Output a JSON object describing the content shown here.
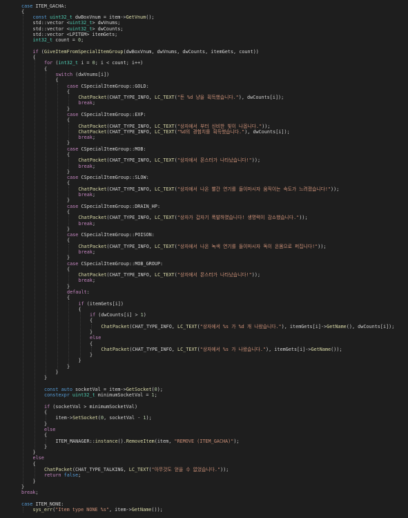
{
  "theme": {
    "background": "#1e1e1e",
    "keyword": "#569cd6",
    "control": "#c586c0",
    "type": "#4ec9b0",
    "function": "#dcdcaa",
    "string": "#ce9178",
    "number": "#b5cea8",
    "text": "#d4d4d4"
  },
  "code_lines": [
    {
      "indent": 0,
      "tokens": [
        [
          "kw",
          "case "
        ],
        [
          "plain",
          "ITEM_GACHA:"
        ]
      ]
    },
    {
      "indent": 0,
      "tokens": [
        [
          "plain",
          "{"
        ]
      ]
    },
    {
      "indent": 1,
      "tokens": [
        [
          "kw",
          "const "
        ],
        [
          "type",
          "uint32_t "
        ],
        [
          "plain",
          "dwBoxVnum = item->"
        ],
        [
          "fn",
          "GetVnum"
        ],
        [
          "plain",
          "();"
        ]
      ]
    },
    {
      "indent": 1,
      "tokens": [
        [
          "plain",
          "std::vector <"
        ],
        [
          "type",
          "uint32_t"
        ],
        [
          "plain",
          "> dwVnums;"
        ]
      ]
    },
    {
      "indent": 1,
      "tokens": [
        [
          "plain",
          "std::vector <"
        ],
        [
          "type",
          "uint32_t"
        ],
        [
          "plain",
          "> dwCounts;"
        ]
      ]
    },
    {
      "indent": 1,
      "tokens": [
        [
          "plain",
          "std::vector <LPITEM> itemGets;"
        ]
      ]
    },
    {
      "indent": 1,
      "tokens": [
        [
          "type",
          "int32_t "
        ],
        [
          "plain",
          "count = "
        ],
        [
          "num",
          "0"
        ],
        [
          "plain",
          ";"
        ]
      ]
    },
    {
      "indent": 1,
      "tokens": []
    },
    {
      "indent": 1,
      "tokens": [
        [
          "ctl",
          "if "
        ],
        [
          "plain",
          "("
        ],
        [
          "fn",
          "GiveItemFromSpecialItemGroup"
        ],
        [
          "plain",
          "(dwBoxVnum, dwVnums, dwCounts, itemGets, count))"
        ]
      ]
    },
    {
      "indent": 1,
      "tokens": [
        [
          "plain",
          "{"
        ]
      ]
    },
    {
      "indent": 2,
      "tokens": [
        [
          "ctl",
          "for "
        ],
        [
          "plain",
          "("
        ],
        [
          "type",
          "int32_t "
        ],
        [
          "plain",
          "i = "
        ],
        [
          "num",
          "0"
        ],
        [
          "plain",
          "; i < count; i++)"
        ]
      ]
    },
    {
      "indent": 2,
      "tokens": [
        [
          "plain",
          "{"
        ]
      ]
    },
    {
      "indent": 3,
      "tokens": [
        [
          "ctl",
          "switch "
        ],
        [
          "plain",
          "(dwVnums[i])"
        ]
      ]
    },
    {
      "indent": 3,
      "tokens": [
        [
          "plain",
          "{"
        ]
      ]
    },
    {
      "indent": 4,
      "tokens": [
        [
          "ctl",
          "case "
        ],
        [
          "plain",
          "CSpecialItemGroup::GOLD:"
        ]
      ]
    },
    {
      "indent": 4,
      "tokens": [
        [
          "plain",
          "{"
        ]
      ]
    },
    {
      "indent": 5,
      "tokens": [
        [
          "fn",
          "ChatPacket"
        ],
        [
          "plain",
          "(CHAT_TYPE_INFO, "
        ],
        [
          "fn",
          "LC_TEXT"
        ],
        [
          "plain",
          "("
        ],
        [
          "str",
          "\"돈 %d 냥을 획득했습니다.\""
        ],
        [
          "plain",
          "), dwCounts[i]);"
        ]
      ]
    },
    {
      "indent": 5,
      "tokens": [
        [
          "ctl",
          "break"
        ],
        [
          "plain",
          ";"
        ]
      ]
    },
    {
      "indent": 4,
      "tokens": [
        [
          "plain",
          "}"
        ]
      ]
    },
    {
      "indent": 4,
      "tokens": [
        [
          "ctl",
          "case "
        ],
        [
          "plain",
          "CSpecialItemGroup::EXP:"
        ]
      ]
    },
    {
      "indent": 4,
      "tokens": [
        [
          "plain",
          "{"
        ]
      ]
    },
    {
      "indent": 5,
      "tokens": [
        [
          "fn",
          "ChatPacket"
        ],
        [
          "plain",
          "(CHAT_TYPE_INFO, "
        ],
        [
          "fn",
          "LC_TEXT"
        ],
        [
          "plain",
          "("
        ],
        [
          "str",
          "\"상자에서 부터 신비한 빛이 나옵니다.\""
        ],
        [
          "plain",
          "));"
        ]
      ]
    },
    {
      "indent": 5,
      "tokens": [
        [
          "fn",
          "ChatPacket"
        ],
        [
          "plain",
          "(CHAT_TYPE_INFO, "
        ],
        [
          "fn",
          "LC_TEXT"
        ],
        [
          "plain",
          "("
        ],
        [
          "str",
          "\"%d의 경험치를 획득했습니다.\""
        ],
        [
          "plain",
          "), dwCounts[i]);"
        ]
      ]
    },
    {
      "indent": 5,
      "tokens": [
        [
          "ctl",
          "break"
        ],
        [
          "plain",
          ";"
        ]
      ]
    },
    {
      "indent": 4,
      "tokens": [
        [
          "plain",
          "}"
        ]
      ]
    },
    {
      "indent": 4,
      "tokens": [
        [
          "ctl",
          "case "
        ],
        [
          "plain",
          "CSpecialItemGroup::MOB:"
        ]
      ]
    },
    {
      "indent": 4,
      "tokens": [
        [
          "plain",
          "{"
        ]
      ]
    },
    {
      "indent": 5,
      "tokens": [
        [
          "fn",
          "ChatPacket"
        ],
        [
          "plain",
          "(CHAT_TYPE_INFO, "
        ],
        [
          "fn",
          "LC_TEXT"
        ],
        [
          "plain",
          "("
        ],
        [
          "str",
          "\"상자에서 몬스터가 나타났습니다!\""
        ],
        [
          "plain",
          "));"
        ]
      ]
    },
    {
      "indent": 5,
      "tokens": [
        [
          "ctl",
          "break"
        ],
        [
          "plain",
          ";"
        ]
      ]
    },
    {
      "indent": 4,
      "tokens": [
        [
          "plain",
          "}"
        ]
      ]
    },
    {
      "indent": 4,
      "tokens": [
        [
          "ctl",
          "case "
        ],
        [
          "plain",
          "CSpecialItemGroup::SLOW:"
        ]
      ]
    },
    {
      "indent": 4,
      "tokens": [
        [
          "plain",
          "{"
        ]
      ]
    },
    {
      "indent": 5,
      "tokens": [
        [
          "fn",
          "ChatPacket"
        ],
        [
          "plain",
          "(CHAT_TYPE_INFO, "
        ],
        [
          "fn",
          "LC_TEXT"
        ],
        [
          "plain",
          "("
        ],
        [
          "str",
          "\"상자에서 나온 빨간 연기를 들이마시자 움직이는 속도가 느려졌습니다!\""
        ],
        [
          "plain",
          "));"
        ]
      ]
    },
    {
      "indent": 5,
      "tokens": [
        [
          "ctl",
          "break"
        ],
        [
          "plain",
          ";"
        ]
      ]
    },
    {
      "indent": 4,
      "tokens": [
        [
          "plain",
          "}"
        ]
      ]
    },
    {
      "indent": 4,
      "tokens": [
        [
          "ctl",
          "case "
        ],
        [
          "plain",
          "CSpecialItemGroup::DRAIN_HP:"
        ]
      ]
    },
    {
      "indent": 4,
      "tokens": [
        [
          "plain",
          "{"
        ]
      ]
    },
    {
      "indent": 5,
      "tokens": [
        [
          "fn",
          "ChatPacket"
        ],
        [
          "plain",
          "(CHAT_TYPE_INFO, "
        ],
        [
          "fn",
          "LC_TEXT"
        ],
        [
          "plain",
          "("
        ],
        [
          "str",
          "\"상자가 갑자기 폭발하였습니다! 생명력이 감소했습니다.\""
        ],
        [
          "plain",
          "));"
        ]
      ]
    },
    {
      "indent": 5,
      "tokens": [
        [
          "ctl",
          "break"
        ],
        [
          "plain",
          ";"
        ]
      ]
    },
    {
      "indent": 4,
      "tokens": [
        [
          "plain",
          "}"
        ]
      ]
    },
    {
      "indent": 4,
      "tokens": [
        [
          "ctl",
          "case "
        ],
        [
          "plain",
          "CSpecialItemGroup::POISON:"
        ]
      ]
    },
    {
      "indent": 4,
      "tokens": [
        [
          "plain",
          "{"
        ]
      ]
    },
    {
      "indent": 5,
      "tokens": [
        [
          "fn",
          "ChatPacket"
        ],
        [
          "plain",
          "(CHAT_TYPE_INFO, "
        ],
        [
          "fn",
          "LC_TEXT"
        ],
        [
          "plain",
          "("
        ],
        [
          "str",
          "\"상자에서 나온 녹색 연기를 들이마시자 독이 온몸으로 퍼집니다!\""
        ],
        [
          "plain",
          "));"
        ]
      ]
    },
    {
      "indent": 5,
      "tokens": [
        [
          "ctl",
          "break"
        ],
        [
          "plain",
          ";"
        ]
      ]
    },
    {
      "indent": 4,
      "tokens": [
        [
          "plain",
          "}"
        ]
      ]
    },
    {
      "indent": 4,
      "tokens": [
        [
          "ctl",
          "case "
        ],
        [
          "plain",
          "CSpecialItemGroup::MOB_GROUP:"
        ]
      ]
    },
    {
      "indent": 4,
      "tokens": [
        [
          "plain",
          "{"
        ]
      ]
    },
    {
      "indent": 5,
      "tokens": [
        [
          "fn",
          "ChatPacket"
        ],
        [
          "plain",
          "(CHAT_TYPE_INFO, "
        ],
        [
          "fn",
          "LC_TEXT"
        ],
        [
          "plain",
          "("
        ],
        [
          "str",
          "\"상자에서 몬스터가 나타났습니다!\""
        ],
        [
          "plain",
          "));"
        ]
      ]
    },
    {
      "indent": 5,
      "tokens": [
        [
          "ctl",
          "break"
        ],
        [
          "plain",
          ";"
        ]
      ]
    },
    {
      "indent": 4,
      "tokens": [
        [
          "plain",
          "}"
        ]
      ]
    },
    {
      "indent": 4,
      "tokens": [
        [
          "ctl",
          "default"
        ],
        [
          "plain",
          ":"
        ]
      ]
    },
    {
      "indent": 4,
      "tokens": [
        [
          "plain",
          "{"
        ]
      ]
    },
    {
      "indent": 5,
      "tokens": [
        [
          "ctl",
          "if "
        ],
        [
          "plain",
          "(itemGets[i])"
        ]
      ]
    },
    {
      "indent": 5,
      "tokens": [
        [
          "plain",
          "{"
        ]
      ]
    },
    {
      "indent": 6,
      "tokens": [
        [
          "ctl",
          "if "
        ],
        [
          "plain",
          "(dwCounts[i] > "
        ],
        [
          "num",
          "1"
        ],
        [
          "plain",
          ")"
        ]
      ]
    },
    {
      "indent": 6,
      "tokens": [
        [
          "plain",
          "{"
        ]
      ]
    },
    {
      "indent": 7,
      "tokens": [
        [
          "fn",
          "ChatPacket"
        ],
        [
          "plain",
          "(CHAT_TYPE_INFO, "
        ],
        [
          "fn",
          "LC_TEXT"
        ],
        [
          "plain",
          "("
        ],
        [
          "str",
          "\"상자에서 %s 가 %d 개 나왔습니다.\""
        ],
        [
          "plain",
          "), itemGets[i]->"
        ],
        [
          "fn",
          "GetName"
        ],
        [
          "plain",
          "(), dwCounts[i]);"
        ]
      ]
    },
    {
      "indent": 6,
      "tokens": [
        [
          "plain",
          "}"
        ]
      ]
    },
    {
      "indent": 6,
      "tokens": [
        [
          "ctl",
          "else"
        ]
      ]
    },
    {
      "indent": 6,
      "tokens": [
        [
          "plain",
          "{"
        ]
      ]
    },
    {
      "indent": 7,
      "tokens": [
        [
          "fn",
          "ChatPacket"
        ],
        [
          "plain",
          "(CHAT_TYPE_INFO, "
        ],
        [
          "fn",
          "LC_TEXT"
        ],
        [
          "plain",
          "("
        ],
        [
          "str",
          "\"상자에서 %s 가 나왔습니다.\""
        ],
        [
          "plain",
          "), itemGets[i]->"
        ],
        [
          "fn",
          "GetName"
        ],
        [
          "plain",
          "());"
        ]
      ]
    },
    {
      "indent": 6,
      "tokens": [
        [
          "plain",
          "}"
        ]
      ]
    },
    {
      "indent": 5,
      "tokens": [
        [
          "plain",
          "}"
        ]
      ]
    },
    {
      "indent": 4,
      "tokens": [
        [
          "plain",
          "}"
        ]
      ]
    },
    {
      "indent": 3,
      "tokens": [
        [
          "plain",
          "}"
        ]
      ]
    },
    {
      "indent": 2,
      "tokens": [
        [
          "plain",
          "}"
        ]
      ]
    },
    {
      "indent": 2,
      "tokens": []
    },
    {
      "indent": 2,
      "tokens": [
        [
          "kw",
          "const "
        ],
        [
          "kw",
          "auto "
        ],
        [
          "plain",
          "socketVal = item->"
        ],
        [
          "fn",
          "GetSocket"
        ],
        [
          "plain",
          "("
        ],
        [
          "num",
          "0"
        ],
        [
          "plain",
          ");"
        ]
      ]
    },
    {
      "indent": 2,
      "tokens": [
        [
          "kw",
          "constexpr "
        ],
        [
          "type",
          "uint32_t "
        ],
        [
          "plain",
          "minimumSocketVal = "
        ],
        [
          "num",
          "1"
        ],
        [
          "plain",
          ";"
        ]
      ]
    },
    {
      "indent": 2,
      "tokens": []
    },
    {
      "indent": 2,
      "tokens": [
        [
          "ctl",
          "if "
        ],
        [
          "plain",
          "(socketVal > minimumSocketVal)"
        ]
      ]
    },
    {
      "indent": 2,
      "tokens": [
        [
          "plain",
          "{"
        ]
      ]
    },
    {
      "indent": 3,
      "tokens": [
        [
          "plain",
          "item->"
        ],
        [
          "fn",
          "SetSocket"
        ],
        [
          "plain",
          "("
        ],
        [
          "num",
          "0"
        ],
        [
          "plain",
          ", socketVal - "
        ],
        [
          "num",
          "1"
        ],
        [
          "plain",
          ");"
        ]
      ]
    },
    {
      "indent": 2,
      "tokens": [
        [
          "plain",
          "}"
        ]
      ]
    },
    {
      "indent": 2,
      "tokens": [
        [
          "ctl",
          "else"
        ]
      ]
    },
    {
      "indent": 2,
      "tokens": [
        [
          "plain",
          "{"
        ]
      ]
    },
    {
      "indent": 3,
      "tokens": [
        [
          "plain",
          "ITEM_MANAGER::"
        ],
        [
          "fn",
          "instance"
        ],
        [
          "plain",
          "()."
        ],
        [
          "fn",
          "RemoveItem"
        ],
        [
          "plain",
          "(item, "
        ],
        [
          "str",
          "\"REMOVE (ITEM_GACHA)\""
        ],
        [
          "plain",
          ");"
        ]
      ]
    },
    {
      "indent": 2,
      "tokens": [
        [
          "plain",
          "}"
        ]
      ]
    },
    {
      "indent": 1,
      "tokens": [
        [
          "plain",
          "}"
        ]
      ]
    },
    {
      "indent": 1,
      "tokens": [
        [
          "ctl",
          "else"
        ]
      ]
    },
    {
      "indent": 1,
      "tokens": [
        [
          "plain",
          "{"
        ]
      ]
    },
    {
      "indent": 2,
      "tokens": [
        [
          "fn",
          "ChatPacket"
        ],
        [
          "plain",
          "(CHAT_TYPE_TALKING, "
        ],
        [
          "fn",
          "LC_TEXT"
        ],
        [
          "plain",
          "("
        ],
        [
          "str",
          "\"아무것도 얻을 수 없었습니다.\""
        ],
        [
          "plain",
          "));"
        ]
      ]
    },
    {
      "indent": 2,
      "tokens": [
        [
          "ctl",
          "return "
        ],
        [
          "kw",
          "false"
        ],
        [
          "plain",
          ";"
        ]
      ]
    },
    {
      "indent": 1,
      "tokens": [
        [
          "plain",
          "}"
        ]
      ]
    },
    {
      "indent": 0,
      "tokens": [
        [
          "plain",
          "}"
        ]
      ]
    },
    {
      "indent": 0,
      "tokens": [
        [
          "ctl",
          "break"
        ],
        [
          "plain",
          ";"
        ]
      ]
    },
    {
      "indent": 0,
      "tokens": []
    },
    {
      "indent": 0,
      "tokens": [
        [
          "kw",
          "case "
        ],
        [
          "plain",
          "ITEM_NONE:"
        ]
      ]
    },
    {
      "indent": 1,
      "tokens": [
        [
          "fn",
          "sys_err"
        ],
        [
          "plain",
          "("
        ],
        [
          "str",
          "\"Item type NONE %s\""
        ],
        [
          "plain",
          ", item->"
        ],
        [
          "fn",
          "GetName"
        ],
        [
          "plain",
          "());"
        ]
      ]
    }
  ]
}
